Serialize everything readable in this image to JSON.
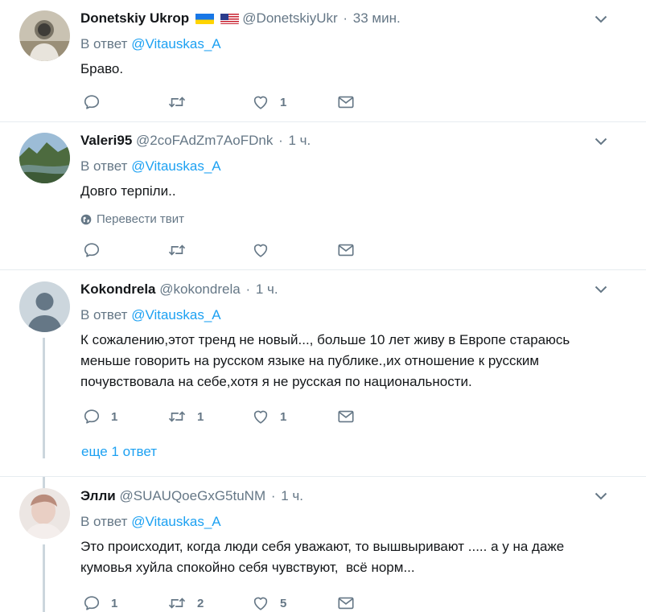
{
  "tweets": [
    {
      "name": "Donetskiy Ukrop",
      "handle": "@DonetskiyUkr",
      "time": "33 мин.",
      "reply_prefix": "В ответ",
      "reply_to": "@Vitauskas_A",
      "text": "Браво.",
      "reply_count": "",
      "retweet_count": "",
      "like_count": "1"
    },
    {
      "name": "Valeri95",
      "handle": "@2coFAdZm7AoFDnk",
      "time": "1 ч.",
      "reply_prefix": "В ответ",
      "reply_to": "@Vitauskas_A",
      "text": "Довго терпіли..",
      "translate": "Перевести твит",
      "reply_count": "",
      "retweet_count": "",
      "like_count": ""
    },
    {
      "name": "Kokondrela",
      "handle": "@kokondrela",
      "time": "1 ч.",
      "reply_prefix": "В ответ",
      "reply_to": "@Vitauskas_A",
      "text_lines": [
        "К сожалению,этот тренд не новый..., больше 10 лет живу в Европе стараюсь",
        "меньше говорить на русском языке на публике.,их отношение к русским",
        "почувствовала на себе,хотя я не русская по национальности."
      ],
      "reply_count": "1",
      "retweet_count": "1",
      "like_count": "1",
      "more_replies": "еще 1 ответ"
    },
    {
      "name": "Элли",
      "handle": "@SUAUQoeGxG5tuNM",
      "time": "1 ч.",
      "reply_prefix": "В ответ",
      "reply_to": "@Vitauskas_A",
      "text_lines": [
        "Это происходит, когда люди себя уважают, то вышвыривают ..... а у на даже",
        "кумовья хуйла спокойно себя чувствуют,  всё норм..."
      ],
      "reply_count": "1",
      "retweet_count": "2",
      "like_count": "5"
    }
  ],
  "separator": "·",
  "colors": {
    "link": "#1da1f2",
    "secondary_text": "#657786",
    "divider": "#e6ecf0",
    "thread_line": "#ccd6dd"
  },
  "icons": [
    "reply-icon",
    "retweet-icon",
    "like-icon",
    "direct-message-icon",
    "chevron-down-icon",
    "globe-icon",
    "ukraine-flag-icon",
    "us-flag-icon"
  ]
}
